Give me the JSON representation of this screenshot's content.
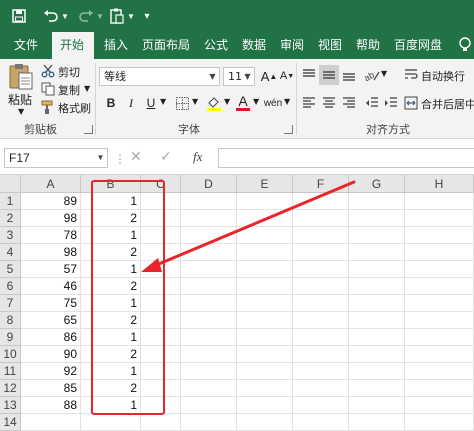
{
  "ribbon": {
    "tabs": [
      "文件",
      "开始",
      "插入",
      "页面布局",
      "公式",
      "数据",
      "审阅",
      "视图",
      "帮助",
      "百度网盘"
    ],
    "active_tab": "开始",
    "clipboard": {
      "paste": "粘贴",
      "cut": "剪切",
      "copy": "复制",
      "format_painter": "格式刷",
      "group_label": "剪贴板"
    },
    "font": {
      "name": "等线",
      "size": "11",
      "bold": "B",
      "italic": "I",
      "underline": "U",
      "font_color_glyph": "A",
      "wen": "wén",
      "group_label": "字体"
    },
    "alignment": {
      "wrap_text": "自动换行",
      "merge_center": "合并后居中",
      "group_label": "对齐方式"
    }
  },
  "formula_bar": {
    "name_box": "F17",
    "cancel": "✕",
    "enter": "✓",
    "fx": "fx",
    "formula": ""
  },
  "sheet": {
    "columns": [
      "A",
      "B",
      "C",
      "D",
      "E",
      "F",
      "G",
      "H"
    ],
    "rows": [
      {
        "num": "1",
        "a": "89",
        "b": "1"
      },
      {
        "num": "2",
        "a": "98",
        "b": "2"
      },
      {
        "num": "3",
        "a": "78",
        "b": "1"
      },
      {
        "num": "4",
        "a": "98",
        "b": "2"
      },
      {
        "num": "5",
        "a": "57",
        "b": "1"
      },
      {
        "num": "6",
        "a": "46",
        "b": "2"
      },
      {
        "num": "7",
        "a": "75",
        "b": "1"
      },
      {
        "num": "8",
        "a": "65",
        "b": "2"
      },
      {
        "num": "9",
        "a": "86",
        "b": "1"
      },
      {
        "num": "10",
        "a": "90",
        "b": "2"
      },
      {
        "num": "11",
        "a": "92",
        "b": "1"
      },
      {
        "num": "12",
        "a": "85",
        "b": "2"
      },
      {
        "num": "13",
        "a": "88",
        "b": "1"
      },
      {
        "num": "14",
        "a": "",
        "b": ""
      }
    ]
  },
  "annotation": {
    "color": "#e8252b"
  },
  "colors": {
    "accent": "#217346"
  }
}
